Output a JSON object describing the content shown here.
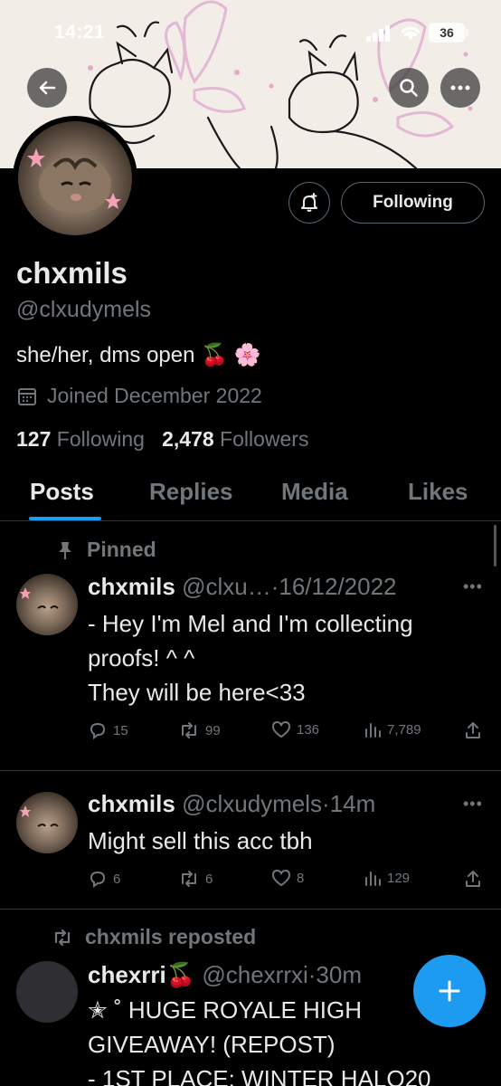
{
  "status_bar": {
    "time": "14:21",
    "battery": "36"
  },
  "header": {
    "back_icon": "arrow-left-icon",
    "search_icon": "search-icon",
    "more_icon": "more-horizontal-icon"
  },
  "profile": {
    "display_name": "chxmils",
    "handle": "@clxudymels",
    "bio": "she/her, dms open 🍒 🌸",
    "joined": "Joined December 2022",
    "following_count": "127",
    "following_label": "Following",
    "followers_count": "2,478",
    "followers_label": "Followers",
    "follow_button": "Following"
  },
  "tabs": [
    {
      "label": "Posts",
      "active": true
    },
    {
      "label": "Replies",
      "active": false
    },
    {
      "label": "Media",
      "active": false
    },
    {
      "label": "Likes",
      "active": false
    }
  ],
  "posts": [
    {
      "pinned_label": "Pinned",
      "name": "chxmils",
      "handle": "@clxu…",
      "time": "16/12/2022",
      "text": "- Hey I'm Mel and I'm collecting proofs! ^ ^\nThey will be here<33",
      "replies": "15",
      "reposts": "99",
      "likes": "136",
      "views": "7,789"
    },
    {
      "name": "chxmils",
      "handle": "@clxudymels",
      "time": "14m",
      "text": "Might sell this acc tbh",
      "replies": "6",
      "reposts": "6",
      "likes": "8",
      "views": "129"
    },
    {
      "reposted_label": "chxmils reposted",
      "name": "chexrri🍒",
      "handle": "@chexrrxi",
      "time": "30m",
      "text": "✭ ˚ HUGE ROYALE HIGH GIVEAWAY! (REPOST)\n - 1ST PLACE: WINTER HALO20"
    }
  ],
  "colors": {
    "accent": "#1d9bf0",
    "muted": "#71767b",
    "text": "#e7e9ea",
    "divider": "#2f3336"
  }
}
